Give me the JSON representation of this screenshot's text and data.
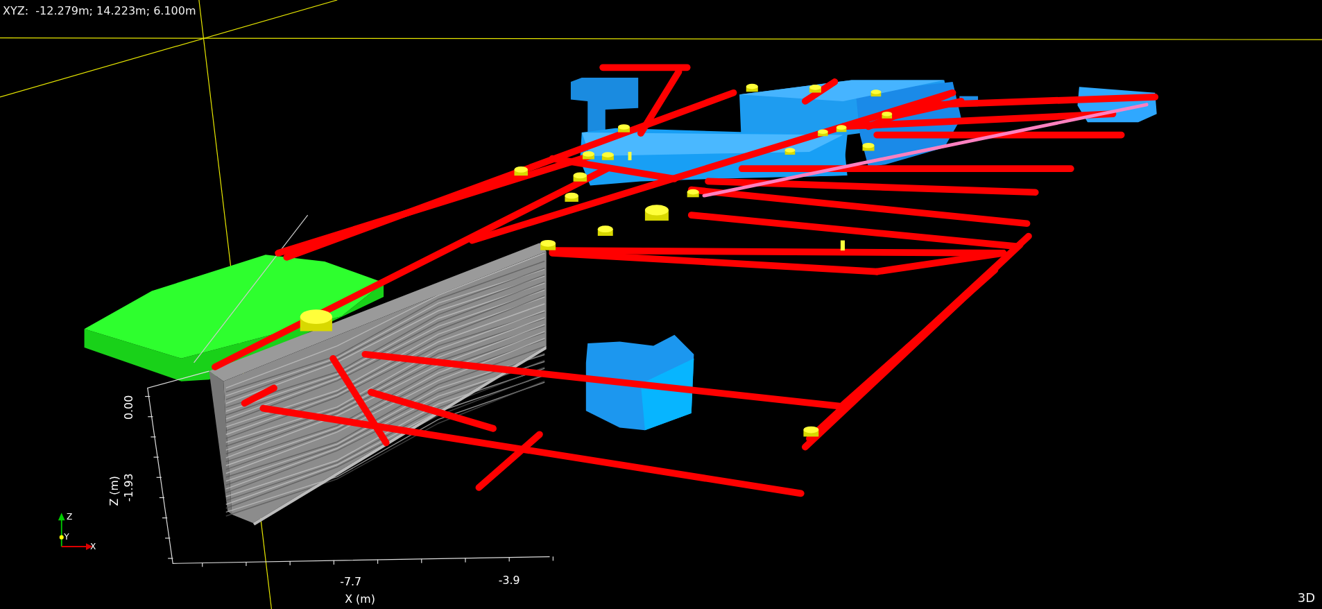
{
  "readout": "XYZ:  -12.279m; 14.223m; 6.100m",
  "axes": {
    "z_label": "Z (m)",
    "z_ticks": [
      "0.00",
      "-1.93"
    ],
    "x_label": "X (m)",
    "x_ticks": [
      "-7.7",
      "-3.9"
    ]
  },
  "gizmo": {
    "x": "X",
    "y": "Y",
    "z": "Z"
  },
  "view_mode": "3D"
}
